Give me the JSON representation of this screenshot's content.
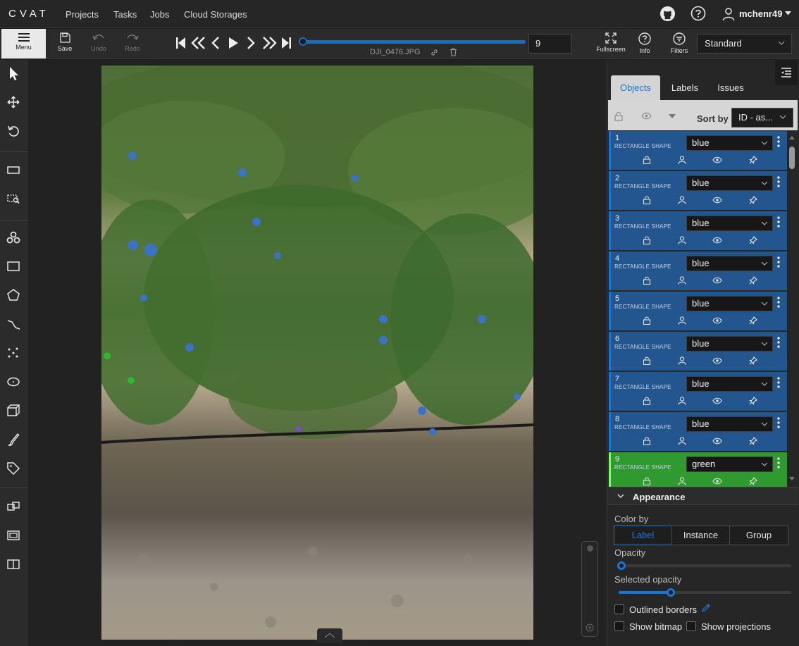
{
  "app": {
    "logo": "CVAT"
  },
  "nav": {
    "projects": "Projects",
    "tasks": "Tasks",
    "jobs": "Jobs",
    "cloud_storages": "Cloud Storages"
  },
  "user": {
    "name": "mchenr49"
  },
  "toolbar": {
    "menu": "Menu",
    "save": "Save",
    "undo": "Undo",
    "redo": "Redo",
    "filename": "DJI_0476.JPG",
    "frame_number": "9",
    "fullscreen": "Fullscreen",
    "info": "Info",
    "filters": "Filters",
    "workspace": "Standard"
  },
  "player": {
    "progress": 0.0
  },
  "sidebar": {
    "tabs": [
      "Objects",
      "Labels",
      "Issues"
    ],
    "active_tab": "Objects",
    "sort_by_label": "Sort by",
    "sort_by_value": "ID - as...",
    "objects": [
      {
        "id": "1",
        "type": "RECTANGLE SHAPE",
        "label": "blue",
        "color": "#23558e"
      },
      {
        "id": "2",
        "type": "RECTANGLE SHAPE",
        "label": "blue",
        "color": "#23558e"
      },
      {
        "id": "3",
        "type": "RECTANGLE SHAPE",
        "label": "blue",
        "color": "#23558e"
      },
      {
        "id": "4",
        "type": "RECTANGLE SHAPE",
        "label": "blue",
        "color": "#23558e"
      },
      {
        "id": "5",
        "type": "RECTANGLE SHAPE",
        "label": "blue",
        "color": "#23558e"
      },
      {
        "id": "6",
        "type": "RECTANGLE SHAPE",
        "label": "blue",
        "color": "#23558e"
      },
      {
        "id": "7",
        "type": "RECTANGLE SHAPE",
        "label": "blue",
        "color": "#23558e"
      },
      {
        "id": "8",
        "type": "RECTANGLE SHAPE",
        "label": "blue",
        "color": "#23558e"
      },
      {
        "id": "9",
        "type": "RECTANGLE SHAPE",
        "label": "green",
        "color": "#2f9a2f"
      }
    ]
  },
  "appearance": {
    "title": "Appearance",
    "color_by_label": "Color by",
    "color_by_options": [
      "Label",
      "Instance",
      "Group"
    ],
    "color_by_active": "Label",
    "opacity_label": "Opacity",
    "opacity_value": 0.0,
    "selected_opacity_label": "Selected opacity",
    "selected_opacity_value": 0.3,
    "outlined_borders": "Outlined borders",
    "show_bitmap": "Show bitmap",
    "show_projections": "Show projections"
  },
  "colors": {
    "accent": "#1677d8",
    "blue_label": "#23558e",
    "green_label": "#2f9a2f"
  }
}
